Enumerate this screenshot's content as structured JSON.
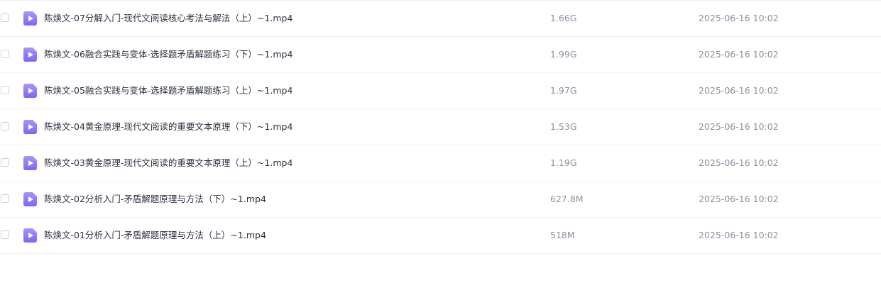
{
  "files": [
    {
      "name": "陈焕文-07分解入门-现代文阅读核心考法与解法（上）~1.mp4",
      "size": "1.66G",
      "date": "2025-06-16 10:02",
      "icon": "video-file-icon"
    },
    {
      "name": "陈焕文-06融合实践与变体-选择题矛盾解题练习（下）~1.mp4",
      "size": "1.99G",
      "date": "2025-06-16 10:02",
      "icon": "video-file-icon"
    },
    {
      "name": "陈焕文-05融合实践与变体-选择题矛盾解题练习（上）~1.mp4",
      "size": "1.97G",
      "date": "2025-06-16 10:02",
      "icon": "video-file-icon"
    },
    {
      "name": "陈焕文-04黄金原理-现代文阅读的重要文本原理（下）~1.mp4",
      "size": "1.53G",
      "date": "2025-06-16 10:02",
      "icon": "video-file-icon"
    },
    {
      "name": "陈焕文-03黄金原理-现代文阅读的重要文本原理（上）~1.mp4",
      "size": "1.19G",
      "date": "2025-06-16 10:02",
      "icon": "video-file-icon"
    },
    {
      "name": "陈焕文-02分析入门-矛盾解题原理与方法（下）~1.mp4",
      "size": "627.8M",
      "date": "2025-06-16 10:02",
      "icon": "video-file-icon"
    },
    {
      "name": "陈焕文-01分析入门-矛盾解题原理与方法（上）~1.mp4",
      "size": "518M",
      "date": "2025-06-16 10:02",
      "icon": "video-file-icon"
    }
  ],
  "colors": {
    "icon_bg_top": "#9d8cff",
    "icon_bg_bottom": "#7c6cf2",
    "divider": "#eef0f4",
    "text": "#2c3140",
    "muted": "#8a90a0"
  }
}
